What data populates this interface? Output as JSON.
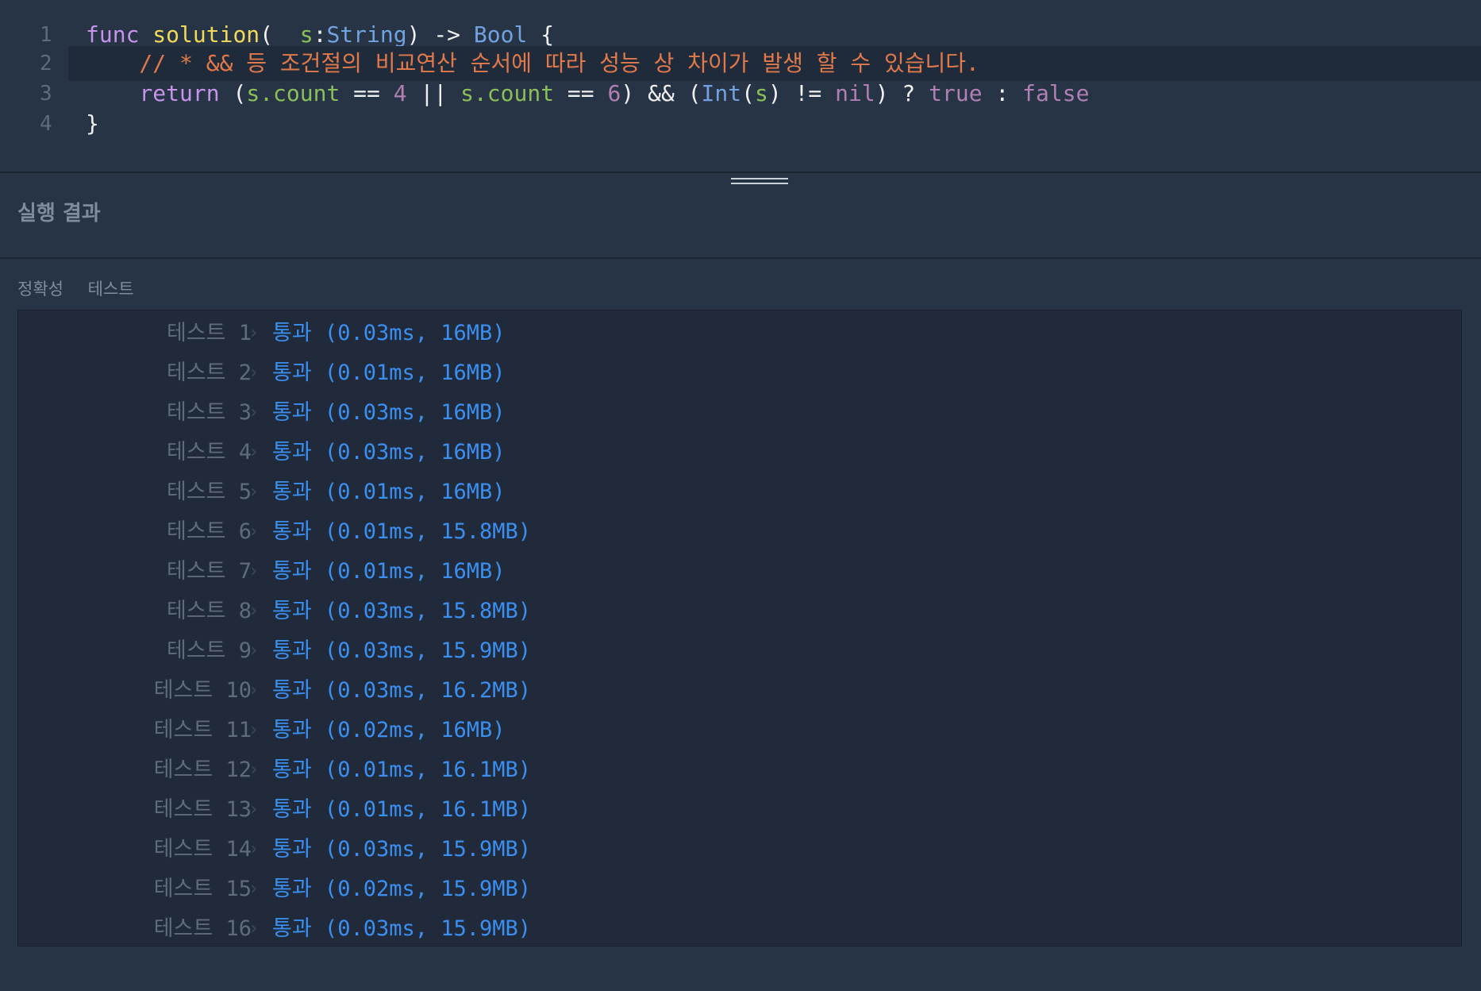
{
  "editor": {
    "lines": [
      {
        "number": "1",
        "tokens": [
          {
            "t": "func ",
            "c": "kw"
          },
          {
            "t": "solution",
            "c": "fn"
          },
          {
            "t": "(",
            "c": "plain"
          },
          {
            "t": "_ ",
            "c": "param"
          },
          {
            "t": "s",
            "c": "param"
          },
          {
            "t": ":",
            "c": "plain"
          },
          {
            "t": "String",
            "c": "type"
          },
          {
            "t": ") -> ",
            "c": "plain"
          },
          {
            "t": "Bool",
            "c": "type"
          },
          {
            "t": " {",
            "c": "plain"
          }
        ]
      },
      {
        "number": "2",
        "tokens": [
          {
            "t": "    // * && 등 조건절의 비교연산 순서에 따라 성능 상 차이가 발생 할 수 있습니다.",
            "c": "comment"
          }
        ]
      },
      {
        "number": "3",
        "tokens": [
          {
            "t": "    ",
            "c": "plain"
          },
          {
            "t": "return",
            "c": "kw"
          },
          {
            "t": " (",
            "c": "plain"
          },
          {
            "t": "s.count",
            "c": "param"
          },
          {
            "t": " == ",
            "c": "plain"
          },
          {
            "t": "4",
            "c": "num"
          },
          {
            "t": " || ",
            "c": "plain"
          },
          {
            "t": "s.count",
            "c": "param"
          },
          {
            "t": " == ",
            "c": "plain"
          },
          {
            "t": "6",
            "c": "num"
          },
          {
            "t": ") && (",
            "c": "plain"
          },
          {
            "t": "Int",
            "c": "type"
          },
          {
            "t": "(",
            "c": "plain"
          },
          {
            "t": "s",
            "c": "param"
          },
          {
            "t": ") != ",
            "c": "plain"
          },
          {
            "t": "nil",
            "c": "num"
          },
          {
            "t": ") ? ",
            "c": "plain"
          },
          {
            "t": "true",
            "c": "bool"
          },
          {
            "t": " : ",
            "c": "plain"
          },
          {
            "t": "false",
            "c": "bool"
          }
        ]
      },
      {
        "number": "4",
        "tokens": [
          {
            "t": "}",
            "c": "plain"
          }
        ]
      }
    ]
  },
  "results": {
    "title": "실행 결과",
    "section_labels": [
      "정확성",
      "테스트"
    ],
    "rows": [
      {
        "label": "테스트 1",
        "value": "통과 (0.03ms, 16MB)"
      },
      {
        "label": "테스트 2",
        "value": "통과 (0.01ms, 16MB)"
      },
      {
        "label": "테스트 3",
        "value": "통과 (0.03ms, 16MB)"
      },
      {
        "label": "테스트 4",
        "value": "통과 (0.03ms, 16MB)"
      },
      {
        "label": "테스트 5",
        "value": "통과 (0.01ms, 16MB)"
      },
      {
        "label": "테스트 6",
        "value": "통과 (0.01ms, 15.8MB)"
      },
      {
        "label": "테스트 7",
        "value": "통과 (0.01ms, 16MB)"
      },
      {
        "label": "테스트 8",
        "value": "통과 (0.03ms, 15.8MB)"
      },
      {
        "label": "테스트 9",
        "value": "통과 (0.03ms, 15.9MB)"
      },
      {
        "label": "테스트 10",
        "value": "통과 (0.03ms, 16.2MB)"
      },
      {
        "label": "테스트 11",
        "value": "통과 (0.02ms, 16MB)"
      },
      {
        "label": "테스트 12",
        "value": "통과 (0.01ms, 16.1MB)"
      },
      {
        "label": "테스트 13",
        "value": "통과 (0.01ms, 16.1MB)"
      },
      {
        "label": "테스트 14",
        "value": "통과 (0.03ms, 15.9MB)"
      },
      {
        "label": "테스트 15",
        "value": "통과 (0.02ms, 15.9MB)"
      },
      {
        "label": "테스트 16",
        "value": "통과 (0.03ms, 15.9MB)"
      }
    ],
    "chevron_icon": "chevron-right-icon",
    "pass_color": "#3b8ff0"
  }
}
